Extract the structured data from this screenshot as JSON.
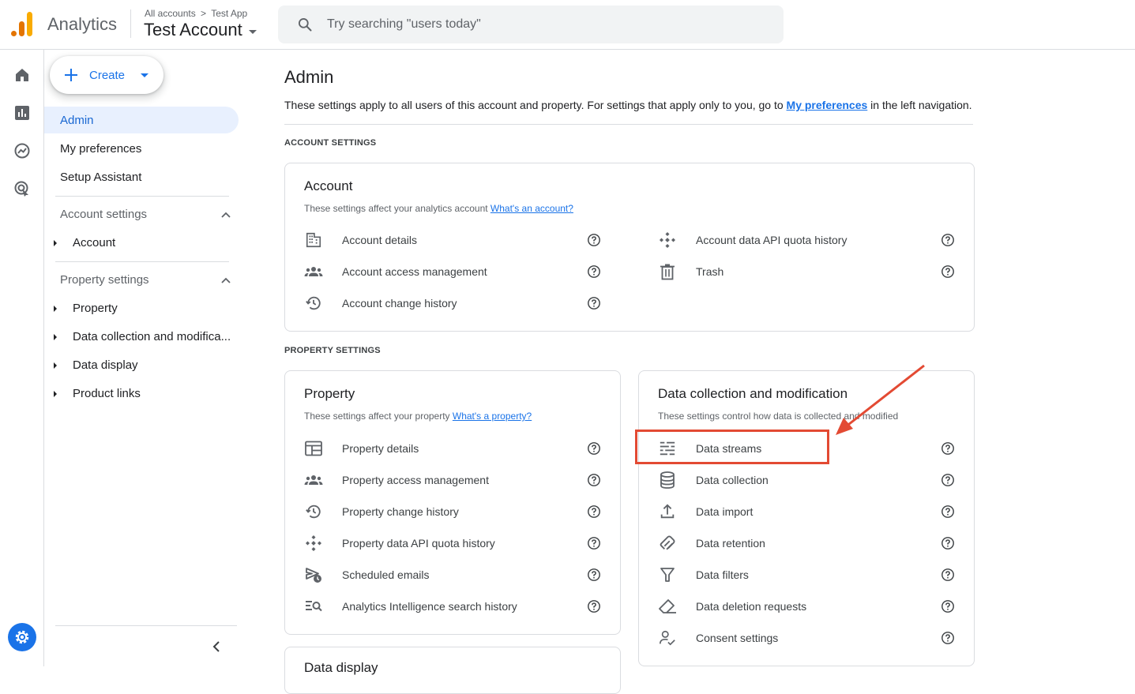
{
  "topbar": {
    "product_name": "Analytics",
    "breadcrumb": [
      "All accounts",
      "Test App"
    ],
    "account_name": "Test Account",
    "search_placeholder": "Try searching \"users today\""
  },
  "nav": {
    "create_label": "Create",
    "items": [
      {
        "label": "Admin",
        "active": true
      },
      {
        "label": "My preferences"
      },
      {
        "label": "Setup Assistant"
      }
    ],
    "account_settings": {
      "title": "Account settings",
      "items": [
        "Account"
      ]
    },
    "property_settings": {
      "title": "Property settings",
      "items": [
        "Property",
        "Data collection and modifica...",
        "Data display",
        "Product links"
      ]
    }
  },
  "main": {
    "title": "Admin",
    "desc_prefix": "These settings apply to all users of this account and property. For settings that apply only to you, go to ",
    "desc_link": "My preferences",
    "desc_suffix": " in the left navigation.",
    "account_caption": "ACCOUNT SETTINGS",
    "property_caption": "PROPERTY SETTINGS",
    "account_card": {
      "title": "Account",
      "sub": "These settings affect your analytics account ",
      "sub_link": "What's an account?",
      "left_items": [
        {
          "label": "Account details",
          "icon": "building-icon"
        },
        {
          "label": "Account access management",
          "icon": "people-icon"
        },
        {
          "label": "Account change history",
          "icon": "history-icon"
        }
      ],
      "right_items": [
        {
          "label": "Account data API quota history",
          "icon": "api-diamond-icon"
        },
        {
          "label": "Trash",
          "icon": "trash-icon"
        }
      ]
    },
    "property_card": {
      "title": "Property",
      "sub": "These settings affect your property ",
      "sub_link": "What's a property?",
      "items": [
        {
          "label": "Property details",
          "icon": "web-window-icon"
        },
        {
          "label": "Property access management",
          "icon": "people-icon"
        },
        {
          "label": "Property change history",
          "icon": "history-icon"
        },
        {
          "label": "Property data API quota history",
          "icon": "api-diamond-icon"
        },
        {
          "label": "Scheduled emails",
          "icon": "scheduled-send-icon"
        },
        {
          "label": "Analytics Intelligence search history",
          "icon": "search-list-icon"
        }
      ]
    },
    "data_card": {
      "title": "Data collection and modification",
      "sub": "These settings control how data is collected and modified",
      "items": [
        {
          "label": "Data streams",
          "icon": "streams-icon"
        },
        {
          "label": "Data collection",
          "icon": "database-icon"
        },
        {
          "label": "Data import",
          "icon": "upload-icon"
        },
        {
          "label": "Data retention",
          "icon": "retention-icon"
        },
        {
          "label": "Data filters",
          "icon": "filter-icon"
        },
        {
          "label": "Data deletion requests",
          "icon": "eraser-icon"
        },
        {
          "label": "Consent settings",
          "icon": "consent-icon"
        }
      ]
    },
    "display_card": {
      "title": "Data display"
    }
  },
  "colors": {
    "accent": "#1a73e8",
    "highlight": "#e34a33",
    "active_bg": "#e8f0fe"
  }
}
